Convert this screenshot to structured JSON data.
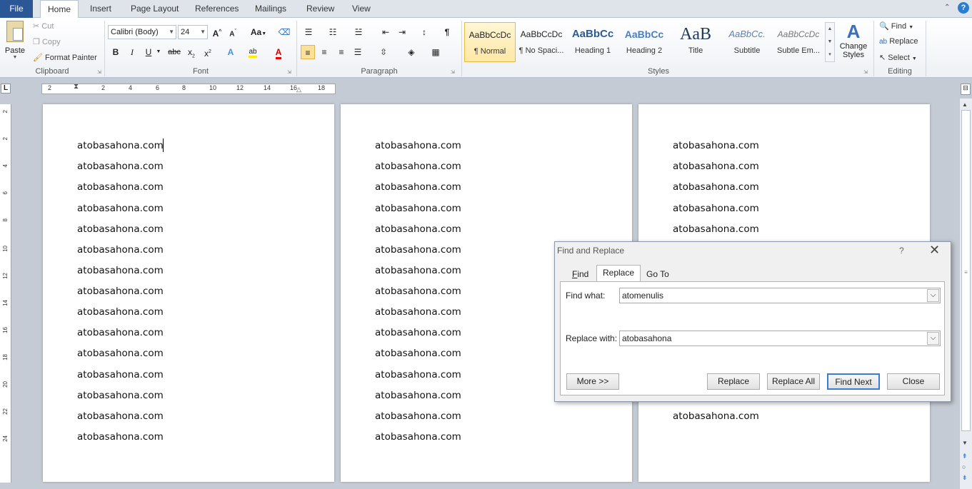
{
  "ribbon_tabs": [
    "File",
    "Home",
    "Insert",
    "Page Layout",
    "References",
    "Mailings",
    "Review",
    "View"
  ],
  "clipboard": {
    "paste": "Paste",
    "cut": "Cut",
    "copy": "Copy",
    "format_painter": "Format Painter",
    "label": "Clipboard"
  },
  "font": {
    "name": "Calibri (Body)",
    "size": "24",
    "label": "Font"
  },
  "paragraph": {
    "label": "Paragraph"
  },
  "styles": {
    "label": "Styles",
    "items": [
      {
        "preview": "AaBbCcDc",
        "name": "¶ Normal"
      },
      {
        "preview": "AaBbCcDc",
        "name": "¶ No Spaci..."
      },
      {
        "preview": "AaBbCc",
        "name": "Heading 1"
      },
      {
        "preview": "AaBbCc",
        "name": "Heading 2"
      },
      {
        "preview": "AaB",
        "name": "Title"
      },
      {
        "preview": "AaBbCc.",
        "name": "Subtitle"
      },
      {
        "preview": "AaBbCcDc",
        "name": "Subtle Em..."
      }
    ],
    "change_styles": "Change Styles"
  },
  "editing": {
    "find": "Find",
    "replace": "Replace",
    "select": "Select",
    "label": "Editing"
  },
  "ruler_ticks": [
    "2",
    "2",
    "4",
    "6",
    "8",
    "10",
    "12",
    "14",
    "16",
    "18"
  ],
  "vruler_ticks": [
    "2",
    "2",
    "4",
    "6",
    "8",
    "10",
    "12",
    "14",
    "16",
    "18",
    "20",
    "22",
    "24"
  ],
  "document": {
    "line_text": "atobasahona.com"
  },
  "dialog": {
    "title": "Find and Replace",
    "help": "?",
    "tabs": [
      "Find",
      "Replace",
      "Go To"
    ],
    "find_label": "Find what:",
    "find_value": "atomenulis",
    "replace_label": "Replace with:",
    "replace_value": "atobasahona",
    "more": "More >>",
    "replace_btn": "Replace",
    "replace_all_btn": "Replace All",
    "find_next_btn": "Find Next",
    "close_btn": "Close"
  },
  "colors": {
    "file_tab": "#2b5797",
    "highlight": "#e8b945",
    "default_btn": "#3b7bd6"
  }
}
